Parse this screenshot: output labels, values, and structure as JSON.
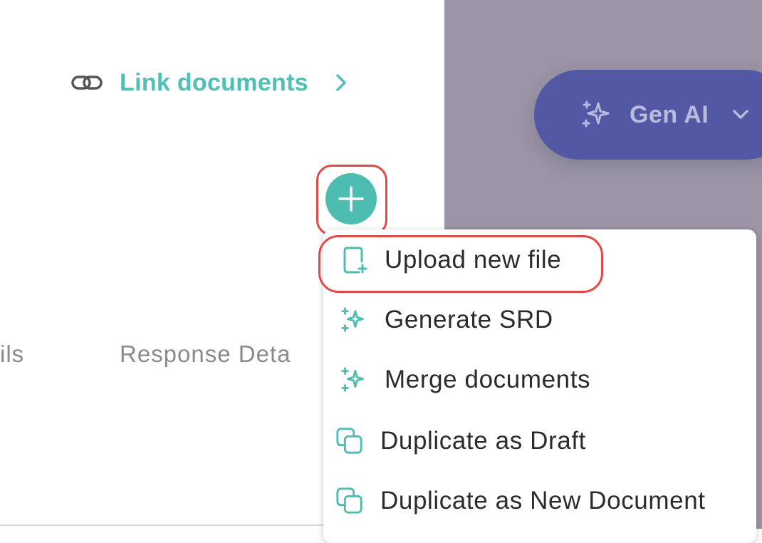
{
  "header": {
    "link_documents_label": "Link documents",
    "link_icon": "link-icon",
    "chevron_icon": "chevron-right-icon"
  },
  "gen_ai": {
    "label": "Gen AI",
    "icon": "sparkle-icon",
    "chevron_icon": "chevron-down-icon"
  },
  "tabs": [
    {
      "label": "ils"
    },
    {
      "label": "Response Deta"
    }
  ],
  "add_button": {
    "icon": "plus-icon"
  },
  "menu": {
    "items": [
      {
        "label": "Upload new file",
        "icon": "file-add-icon"
      },
      {
        "label": "Generate SRD",
        "icon": "sparkle-icon"
      },
      {
        "label": "Merge documents",
        "icon": "sparkle-icon"
      },
      {
        "label": "Duplicate as Draft",
        "icon": "copy-icon"
      },
      {
        "label": "Duplicate as New Document",
        "icon": "copy-icon"
      }
    ]
  },
  "colors": {
    "accent": "#4dbdb2",
    "highlight": "#e0494a",
    "gen_ai_bg": "#5258a4",
    "overlay": "#9b95a7"
  }
}
